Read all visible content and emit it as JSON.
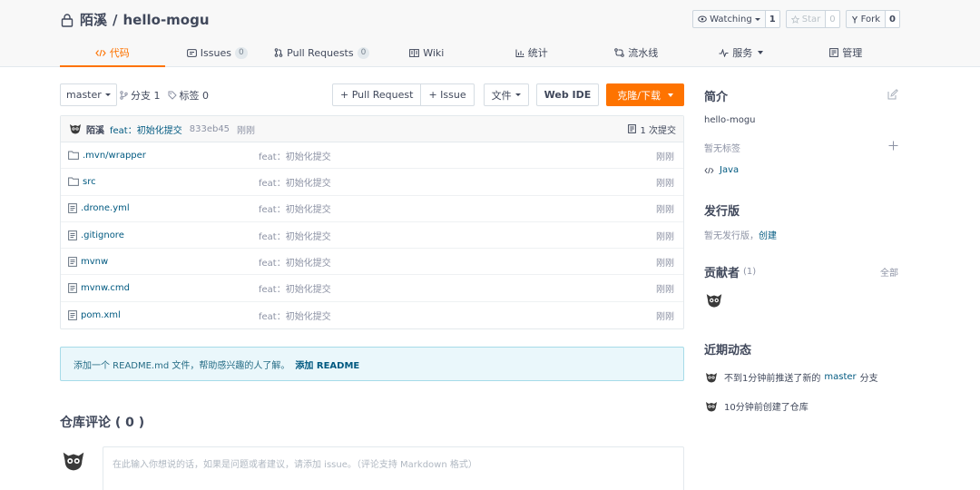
{
  "repo": {
    "owner": "陌溪",
    "separator": "/",
    "name": "hello-mogu"
  },
  "actions": {
    "watch": {
      "label": "Watching",
      "count": "1"
    },
    "star": {
      "label": "Star",
      "count": "0"
    },
    "fork": {
      "label": "Fork",
      "count": "0"
    }
  },
  "tabs": [
    {
      "label": "代码",
      "active": true
    },
    {
      "label": "Issues",
      "badge": "0"
    },
    {
      "label": "Pull Requests",
      "badge": "0"
    },
    {
      "label": "Wiki"
    },
    {
      "label": "统计"
    },
    {
      "label": "流水线"
    },
    {
      "label": "服务"
    },
    {
      "label": "管理"
    }
  ],
  "toolbar": {
    "branch": "master",
    "branches": "分支 1",
    "tags": "标签 0",
    "pull_request": "+ Pull Request",
    "issue": "+ Issue",
    "file": "文件",
    "web_ide": "Web IDE",
    "clone": "克隆/下载"
  },
  "last_commit": {
    "author": "陌溪",
    "message": "feat：初始化提交",
    "sha": "833eb45",
    "time": "刚刚",
    "count": "1 次提交"
  },
  "files": [
    {
      "type": "folder",
      "name": ".mvn/wrapper",
      "message": "feat：初始化提交",
      "time": "刚刚"
    },
    {
      "type": "folder",
      "name": "src",
      "message": "feat：初始化提交",
      "time": "刚刚"
    },
    {
      "type": "file",
      "name": ".drone.yml",
      "message": "feat：初始化提交",
      "time": "刚刚"
    },
    {
      "type": "file",
      "name": ".gitignore",
      "message": "feat：初始化提交",
      "time": "刚刚"
    },
    {
      "type": "file",
      "name": "mvnw",
      "message": "feat：初始化提交",
      "time": "刚刚"
    },
    {
      "type": "file",
      "name": "mvnw.cmd",
      "message": "feat：初始化提交",
      "time": "刚刚"
    },
    {
      "type": "file",
      "name": "pom.xml",
      "message": "feat：初始化提交",
      "time": "刚刚"
    }
  ],
  "readme_tip": {
    "text": "添加一个 README.md 文件，帮助感兴趣的人了解。",
    "link": "添加 README"
  },
  "comments": {
    "title": "仓库评论 ( 0 )",
    "placeholder": "在此输入你想说的话，如果是问题或者建议，请添加 issue。（评论支持 Markdown 格式）"
  },
  "sidebar": {
    "intro": {
      "title": "简介",
      "description": "hello-mogu",
      "no_tags": "暂无标签",
      "language": "Java"
    },
    "releases": {
      "title": "发行版",
      "none": "暂无发行版，",
      "create": "创建"
    },
    "contributors": {
      "title": "贡献者",
      "count": "(1)",
      "all": "全部"
    },
    "activity": {
      "title": "近期动态",
      "items": [
        {
          "prefix": "不到1分钟前推送了新的",
          "branch": "master",
          "suffix": "分支"
        },
        {
          "text": "10分钟前创建了仓库"
        }
      ]
    }
  },
  "colors": {
    "accent": "#fe7300",
    "link": "#005980",
    "muted": "#8c92a4",
    "tip_bg": "#eaf7fb"
  }
}
